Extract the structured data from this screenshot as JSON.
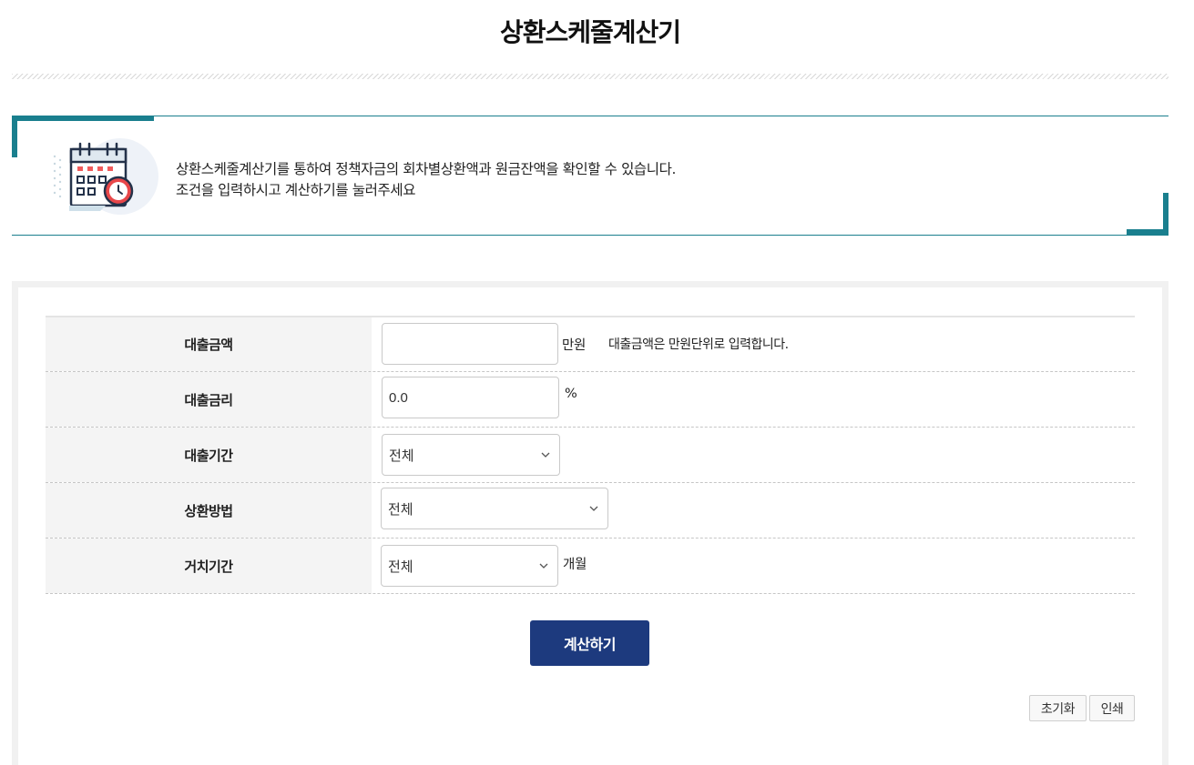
{
  "page": {
    "title": "상환스케줄계산기"
  },
  "intro": {
    "line1": "상환스케줄계산기를 통하여 정책자금의 회차별상환액과 원금잔액을 확인할 수 있습니다.",
    "line2": "조건을 입력하시고 계산하기를 눌러주세요",
    "icon": "calendar-clock-icon"
  },
  "form": {
    "loan_amount": {
      "label": "대출금액",
      "value": "",
      "unit": "만원",
      "hint": "대출금액은 만원단위로 입력합니다."
    },
    "interest_rate": {
      "label": "대출금리",
      "value": "0.0",
      "unit": "%"
    },
    "loan_period": {
      "label": "대출기간",
      "selected": "전체"
    },
    "repayment_method": {
      "label": "상환방법",
      "selected": "전체"
    },
    "grace_period": {
      "label": "거치기간",
      "selected": "전체",
      "unit": "개월"
    }
  },
  "actions": {
    "calculate": "계산하기",
    "reset": "초기화",
    "print": "인쇄"
  },
  "colors": {
    "accent_teal": "#1a7f8e",
    "button_navy": "#1d3a7e",
    "label_bg": "#f4f4f4"
  }
}
